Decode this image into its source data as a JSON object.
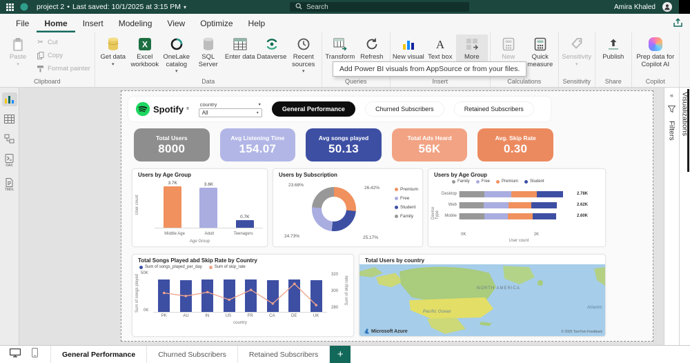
{
  "titlebar": {
    "project_name": "project 2",
    "separator": "•",
    "saved_text": "Last saved: 10/1/2025 at 3:15 PM",
    "search_placeholder": "Search",
    "user_name": "Amira Khaled"
  },
  "ribbon_tabs": [
    {
      "label": "File"
    },
    {
      "label": "Home"
    },
    {
      "label": "Insert"
    },
    {
      "label": "Modeling"
    },
    {
      "label": "View"
    },
    {
      "label": "Optimize"
    },
    {
      "label": "Help"
    }
  ],
  "ribbon": {
    "clipboard": {
      "label": "Clipboard",
      "items": [
        "Paste",
        "Cut",
        "Copy",
        "Format painter"
      ]
    },
    "data": {
      "label": "Data",
      "items": [
        "Get data",
        "Excel workbook",
        "OneLake catalog",
        "SQL Server",
        "Enter data",
        "Dataverse",
        "Recent sources"
      ]
    },
    "queries": {
      "label": "Queries",
      "items": [
        "Transform data",
        "Refresh"
      ]
    },
    "insert": {
      "label": "Insert",
      "items": [
        "New visual",
        "Text box",
        "More visuals"
      ]
    },
    "calculations": {
      "label": "Calculations",
      "items": [
        "New measure",
        "Quick measure"
      ]
    },
    "sensitivity": {
      "label": "Sensitivity",
      "items": [
        "Sensitivity"
      ]
    },
    "share": {
      "label": "Share",
      "items": [
        "Publish"
      ]
    },
    "copilot": {
      "label": "Copilot",
      "items": [
        "Prep data for Copilot AI"
      ]
    }
  },
  "tooltip": {
    "text": "Add Power BI visuals from AppSource or from your files."
  },
  "side_nav": {
    "dax_label": "DAX",
    "tmdl_label": "TMDL"
  },
  "right_panes": {
    "filters_label": "Filters",
    "visualizations_label": "Visualizations"
  },
  "dashboard": {
    "brand": "Spotify",
    "brand_mark": "®",
    "slicer": {
      "label": "country",
      "value": "All"
    },
    "nav_tabs": [
      "General Performance",
      "Churned Subscribers",
      "Retained Subscribers"
    ],
    "kpis": [
      {
        "label": "Total Users",
        "value": "8000",
        "color": "#8e8e8e"
      },
      {
        "label": "Avg Listening Time",
        "value": "154.07",
        "color": "#b2b6e6"
      },
      {
        "label": "Avg songs played",
        "value": "50.13",
        "color": "#3d4fa3"
      },
      {
        "label": "Total Ads Heard",
        "value": "56K",
        "color": "#f2a384"
      },
      {
        "label": "Avg. Skip Rate",
        "value": "0.30",
        "color": "#ec8a5f"
      }
    ],
    "age_chart": {
      "type": "bar",
      "title": "Users by Age Group",
      "ylabel": "User count",
      "xlabel": "Age Group",
      "categories": [
        "Middle Age",
        "Adult",
        "Teenagers"
      ],
      "labels": [
        "3.7K",
        "3.6K",
        "0.7K"
      ],
      "values": [
        3.7,
        3.6,
        0.7
      ],
      "max": 4.2,
      "colors": [
        "#f0915e",
        "#a9ade0",
        "#3d4fa3"
      ]
    },
    "subscription_chart": {
      "type": "pie",
      "title": "Users by Subscription",
      "legend": [
        "Premium",
        "Free",
        "Student",
        "Family"
      ],
      "legend_colors": [
        "#f0915e",
        "#a9ade0",
        "#3d4fa3",
        "#989898"
      ],
      "values": [
        26.42,
        25.17,
        24.73,
        23.68
      ],
      "slice_colors": [
        "#f0915e",
        "#3d4fa3",
        "#a9ade0",
        "#989898"
      ],
      "labels": {
        "top_left": "23.68%",
        "top_right": "26.42%",
        "bottom_left": "24.73%",
        "bottom_right": "25.17%"
      }
    },
    "device_chart": {
      "type": "stacked-bar",
      "title": "Users by Age Group",
      "legend": [
        "Family",
        "Free",
        "Premium",
        "Student"
      ],
      "legend_colors": [
        "#989898",
        "#a9ade0",
        "#f0915e",
        "#3d4fa3"
      ],
      "ylabel": "Device Type",
      "xlabel": "User count",
      "categories": [
        "Desktop",
        "Web",
        "Mobile"
      ],
      "totals": [
        "2.78K",
        "2.62K",
        "2.60K"
      ],
      "values": [
        2.78,
        2.62,
        2.6
      ],
      "max": 3.1,
      "segments": [
        [
          0.24,
          0.26,
          0.25,
          0.25
        ],
        [
          0.25,
          0.25,
          0.24,
          0.26
        ],
        [
          0.26,
          0.24,
          0.26,
          0.24
        ]
      ],
      "x_ticks": [
        "0K",
        "2K"
      ]
    },
    "combo_chart": {
      "type": "combo",
      "title": "Total Songs Played abd Skip Rate by Country",
      "legend": [
        "Sum of songs_played_per_day",
        "Sum of skip_rate"
      ],
      "legend_colors": [
        "#3d4fa3",
        "#f0a48c"
      ],
      "ylabel_left": "Sum of songs played",
      "ylabel_right": "Sum of skip rate",
      "xlabel": "country",
      "categories": [
        "PK",
        "AU",
        "IN",
        "US",
        "FR",
        "CA",
        "DE",
        "UK"
      ],
      "bar_values": [
        50,
        49,
        50,
        50,
        50,
        49,
        50,
        49
      ],
      "bar_max": 58,
      "left_ticks": [
        "50K",
        "0K"
      ],
      "line_values": [
        300,
        296,
        301,
        291,
        304,
        286,
        312,
        284
      ],
      "line_range": [
        275,
        325
      ],
      "right_ticks": [
        "320",
        "300",
        "280"
      ]
    },
    "map_chart": {
      "type": "map",
      "title": "Total Users by country",
      "region_label": "NORTH AMERICA",
      "ocean_label": "Pacific Ocean",
      "ocean_label_2": "Atlantic",
      "attribution": "Microsoft Azure",
      "copyright": "© 2025 TomTom Feedback"
    }
  },
  "bottom_bar": {
    "tabs": [
      "General Performance",
      "Churned Subscribers",
      "Retained Subscribers"
    ],
    "add_label": "+"
  }
}
